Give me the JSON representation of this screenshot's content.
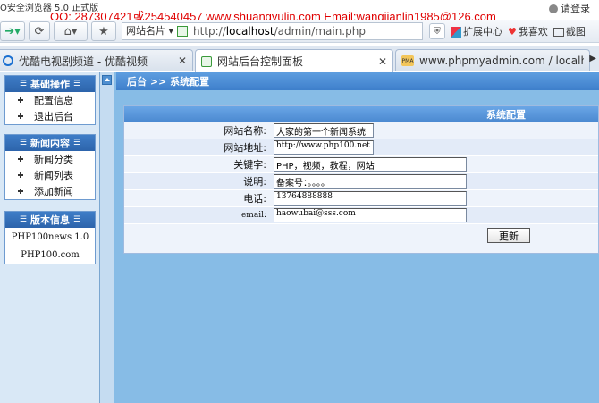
{
  "browser": {
    "title": "O安全浏览器 5.0 正式版",
    "watermark": "QQ: 287307421或254540457 www.shuangyulin.com Email:wangjianlin1985@126.com",
    "login_label": "请登录",
    "site_name_label": "网站名片",
    "address": {
      "prefix": "http://",
      "host": "localhost",
      "path": "/admin/main.php"
    },
    "toolbar_right": {
      "extensions_label": "扩展中心",
      "favorites_label": "我喜欢",
      "screenshot_label": "截图"
    }
  },
  "tabs": [
    {
      "label": "优酷电视剧频道 - 优酷视频",
      "icon": "youku-icon"
    },
    {
      "label": "网站后台控制面板",
      "icon": "page-icon"
    },
    {
      "label": "www.phpmyadmin.com / localhos…",
      "icon": "phpmyadmin-icon"
    }
  ],
  "sidebar": {
    "groups": [
      {
        "title": "基础操作",
        "items": [
          "配置信息",
          "退出后台"
        ]
      },
      {
        "title": "新闻内容",
        "items": [
          "新闻分类",
          "新闻列表",
          "添加新闻"
        ]
      },
      {
        "title": "版本信息",
        "items": [
          "PHP100news 1.0",
          "PHP100.com"
        ]
      }
    ],
    "decor": "☰"
  },
  "breadcrumb": "后台 >> 系统配置",
  "config": {
    "title": "系统配置",
    "fields": [
      {
        "label": "网站名称:",
        "value": "大家的第一个新闻系统"
      },
      {
        "label": "网站地址:",
        "value": "http://www.php100.net"
      },
      {
        "label": "关键字:",
        "value": "PHP，视频，教程，网站"
      },
      {
        "label": "说明:",
        "value": "备案号：。。。。"
      },
      {
        "label": "电话:",
        "value": "13764888888"
      },
      {
        "label": "email:",
        "value": "haowubai@sss.com"
      }
    ],
    "submit_label": "更新"
  }
}
